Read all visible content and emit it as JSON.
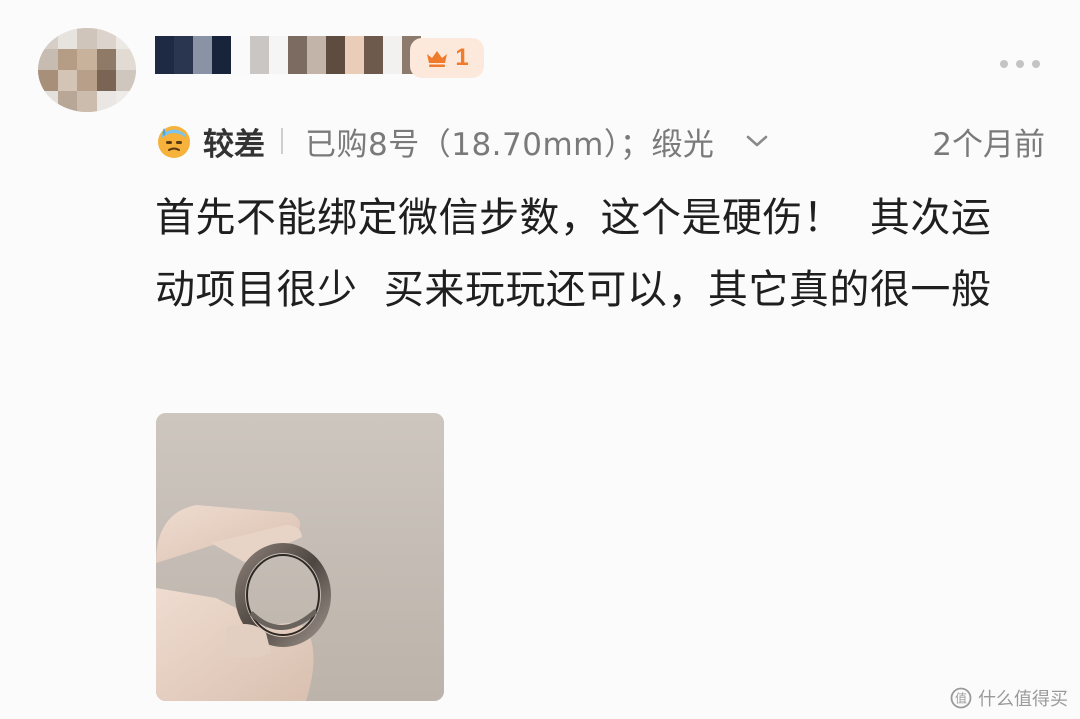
{
  "user": {
    "badge_count": "1"
  },
  "review": {
    "rating_label": "较差",
    "spec": "已购8号（18.70mm）；缎光",
    "time": "2个月前",
    "text": "首先不能绑定微信步数，这个是硬伤！  其次运动项目很少  买来玩玩还可以，其它真的很一般"
  },
  "watermark": {
    "text": "什么值得买"
  },
  "colors": {
    "badge_bg": "#fde9dc",
    "badge_accent": "#f07b2c",
    "secondary_text": "#7a7a7a"
  }
}
